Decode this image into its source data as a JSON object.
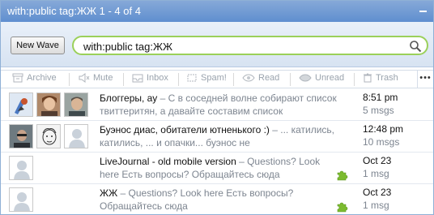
{
  "window": {
    "title": "with:public tag:ЖЖ 1 - 4 of 4"
  },
  "search": {
    "new_wave_label": "New Wave",
    "query": "with:public tag:ЖЖ"
  },
  "toolbar": {
    "archive": "Archive",
    "mute": "Mute",
    "inbox": "Inbox",
    "spam": "Spam!",
    "read": "Read",
    "unread": "Unread",
    "trash": "Trash",
    "more": "•••"
  },
  "waves": [
    {
      "title": "Блоггеры, ау",
      "snippet": " – С в соседней волне собирают список твиттеритян, а давайте составим список",
      "time": "8:51 pm",
      "count": "5 msgs"
    },
    {
      "title": "Буэнос диас, обитатели ютненького :)",
      "snippet": " – ... катились, катились, ... и опачки... буэнос не",
      "time": "12:48 pm",
      "count": "10 msgs"
    },
    {
      "title": "LiveJournal - old mobile version",
      "snippet": " – Questions? Look here Есть вопросы? Обращайтесь сюда",
      "time": "Oct 23",
      "count": "1 msg"
    },
    {
      "title": "ЖЖ",
      "snippet": " – Questions? Look here Есть вопросы? Обращайтесь сюда",
      "time": "Oct 23",
      "count": "1 msg"
    }
  ]
}
